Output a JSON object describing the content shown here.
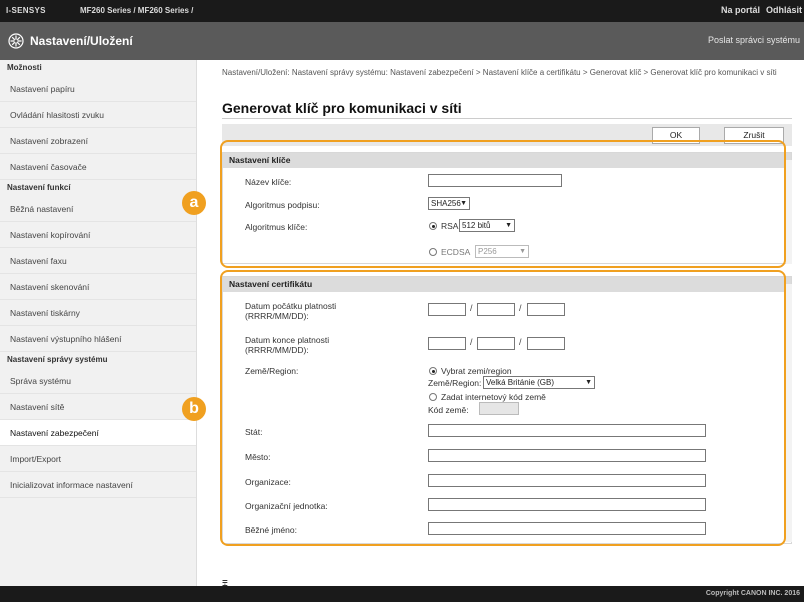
{
  "topbar": {
    "brand": "I-SENSYS",
    "model": "MF260 Series / MF260 Series /",
    "portal": "Na portál",
    "logout": "Odhlásit"
  },
  "titlebar": {
    "title": "Nastavení/Uložení",
    "mail_admin": "Poslat správci systému"
  },
  "sidebar": {
    "sections": [
      {
        "title": "Možnosti",
        "items": [
          "Nastavení papíru",
          "Ovládání hlasitosti zvuku",
          "Nastavení zobrazení",
          "Nastavení časovače"
        ]
      },
      {
        "title": "Nastavení funkcí",
        "items": [
          "Běžná nastavení",
          "Nastavení kopírování",
          "Nastavení faxu",
          "Nastavení skenování",
          "Nastavení tiskárny",
          "Nastavení výstupního hlášení"
        ]
      },
      {
        "title": "Nastavení správy systému",
        "items": [
          "Správa systému",
          "Nastavení sítě",
          "Nastavení zabezpečení",
          "Import/Export",
          "Inicializovat informace nastavení"
        ]
      }
    ],
    "active_item": "Nastavení zabezpečení"
  },
  "main": {
    "breadcrumb": "Nastavení/Uložení: Nastavení správy systému: Nastavení zabezpečení > Nastavení klíče a certifikátu > Generovat klíč > Generovat klíč pro komunikaci v síti",
    "page_title": "Generovat klíč pro komunikaci v síti",
    "ok_label": "OK",
    "cancel_label": "Zrušit",
    "key_panel": {
      "heading": "Nastavení klíče",
      "key_name_label": "Název klíče:",
      "sig_algo_label": "Algoritmus podpisu:",
      "sig_algo_value": "SHA256",
      "key_algo_label": "Algoritmus klíče:",
      "rsa_label": "RSA",
      "rsa_bits_value": "512 bitů",
      "ecdsa_label": "ECDSA",
      "ecdsa_curve_value": "P256"
    },
    "cert_panel": {
      "heading": "Nastavení certifikátu",
      "start_date_label": "Datum počátku platnosti (RRRR/MM/DD):",
      "end_date_label": "Datum konce platnosti (RRRR/MM/DD):",
      "country_label": "Země/Region:",
      "select_country_label": "Vybrat zemi/region",
      "country_region_label": "Země/Region:",
      "country_value": "Velká Británie (GB)",
      "internet_code_label": "Zadat internetový kód země",
      "country_code_label": "Kód země:",
      "state_label": "Stát:",
      "city_label": "Město:",
      "organization_label": "Organizace:",
      "org_unit_label": "Organizační jednotka:",
      "common_name_label": "Běžné jméno:",
      "slash": "/"
    },
    "top_of_page_icon": "⩱"
  },
  "annotations": {
    "badge_a": "a",
    "badge_b": "b",
    "accent_color": "#f0a020"
  },
  "footer": {
    "copyright": "Copyright CANON INC. 2016"
  },
  "icons": {
    "gear": "gear-icon",
    "top": "top-of-page-icon"
  }
}
